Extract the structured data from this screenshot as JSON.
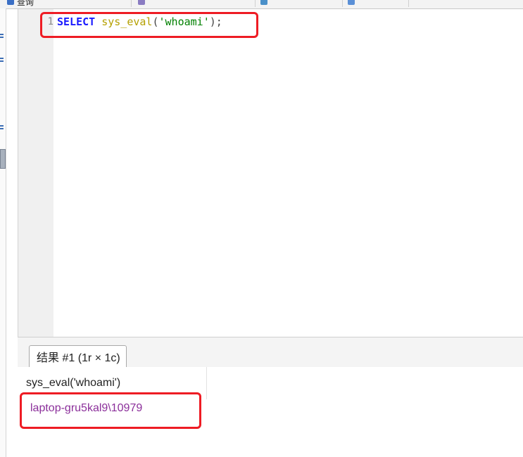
{
  "app": {
    "top_tabs": [
      {
        "label": "查询",
        "sublabel": "",
        "icon": "query-icon",
        "color": "#3b6fc5"
      },
      {
        "label": "",
        "sublabel": "",
        "icon": "table-icon",
        "color": "#8a7cc2"
      },
      {
        "label": "",
        "sublabel": "",
        "icon": "grid-icon",
        "color": "#4a90c9"
      },
      {
        "label": "",
        "sublabel": "",
        "icon": "data-icon",
        "color": "#5a8fd6"
      }
    ]
  },
  "editor": {
    "line_number": "1",
    "query_tokens": {
      "keyword": "SELECT",
      "space": " ",
      "function": "sys_eval",
      "open_paren": "(",
      "string": "'whoami'",
      "close": ");"
    }
  },
  "results": {
    "tab_label": "结果 #1 (1r × 1c)",
    "column_header": "sys_eval('whoami')",
    "cell_value": "laptop-gru5kal9\\10979"
  },
  "colors": {
    "highlight": "#ee1c24",
    "keyword": "#1a1aff",
    "function": "#b5a000",
    "string": "#008000",
    "cell_text": "#8b2f9a"
  }
}
